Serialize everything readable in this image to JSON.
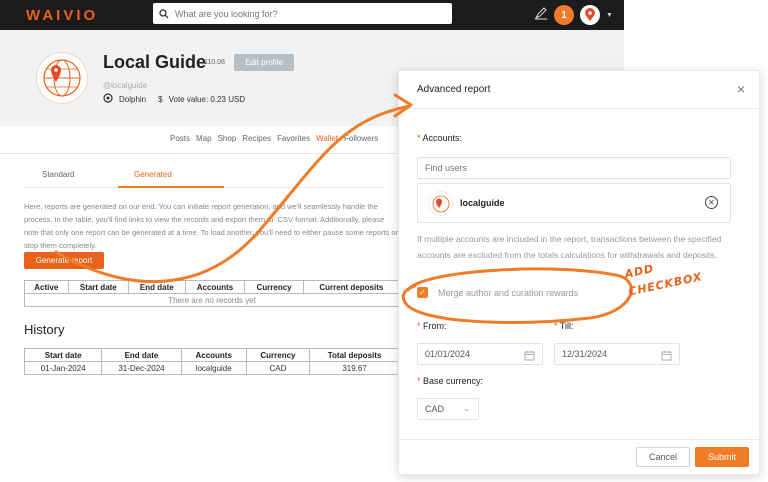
{
  "nav": {
    "logo": "WAIVIO",
    "search_placeholder": "What are you looking for?",
    "notifications": "1"
  },
  "profile": {
    "name": "Local Guide",
    "reputation": "110.08",
    "edit_label": "Edit profile",
    "handle": "@localguide",
    "rank": "Dolphin",
    "vote_value": "Vote value: 0.23 USD",
    "vote_symbol": "$"
  },
  "profile_tabs": [
    "Posts",
    "Map",
    "Shop",
    "Recipes",
    "Favorites",
    "Wallet",
    "Followers"
  ],
  "wallet": {
    "tabs": [
      "Standard",
      "Generated"
    ],
    "description": "Here, reports are generated on our end. You can initiate report generation, and we'll seamlessly handle the process. In the table, you'll find links to view the records and export them to .CSV format. Additionally, please note that only one report can be generated at a time. To load another, you'll need to either pause some reports or stop them completely.",
    "generate_label": "Generate report",
    "active_table": {
      "headers": [
        "Active",
        "Start date",
        "End date",
        "Accounts",
        "Currency",
        "Current deposits"
      ],
      "empty": "There are no records yet"
    },
    "history_title": "History",
    "history_table": {
      "headers": [
        "Start date",
        "End date",
        "Accounts",
        "Currency",
        "Total deposits"
      ],
      "rows": [
        [
          "01-Jan-2024",
          "31-Dec-2024",
          "localguide",
          "CAD",
          "319.67"
        ]
      ]
    }
  },
  "modal": {
    "title": "Advanced report",
    "close": "×",
    "accounts_label": "Accounts:",
    "find_placeholder": "Find users",
    "account_name": "localguide",
    "info": "If multiple accounts are included in the report, transactions between the specified accounts are excluded from the totals calculations for withdrawals and deposits.",
    "checkbox_label": "Merge author and curation rewards",
    "checkbox_checked": true,
    "from_label": "From:",
    "till_label": "Till:",
    "from_value": "01/01/2024",
    "till_value": "12/31/2024",
    "currency_label": "Base currency:",
    "currency_value": "CAD",
    "cancel_label": "Cancel",
    "submit_label": "Submit",
    "required_mark": "*"
  },
  "annotation": {
    "line1": "ADD",
    "line2": "CHECKBOX"
  },
  "colors": {
    "accent": "#f07c27",
    "topbar": "#1b1b1b"
  },
  "icons": [
    "search-icon",
    "edit-icon",
    "map-pin-icon",
    "dolphin-icon",
    "calendar-icon",
    "close-icon",
    "chevron-down-icon"
  ]
}
